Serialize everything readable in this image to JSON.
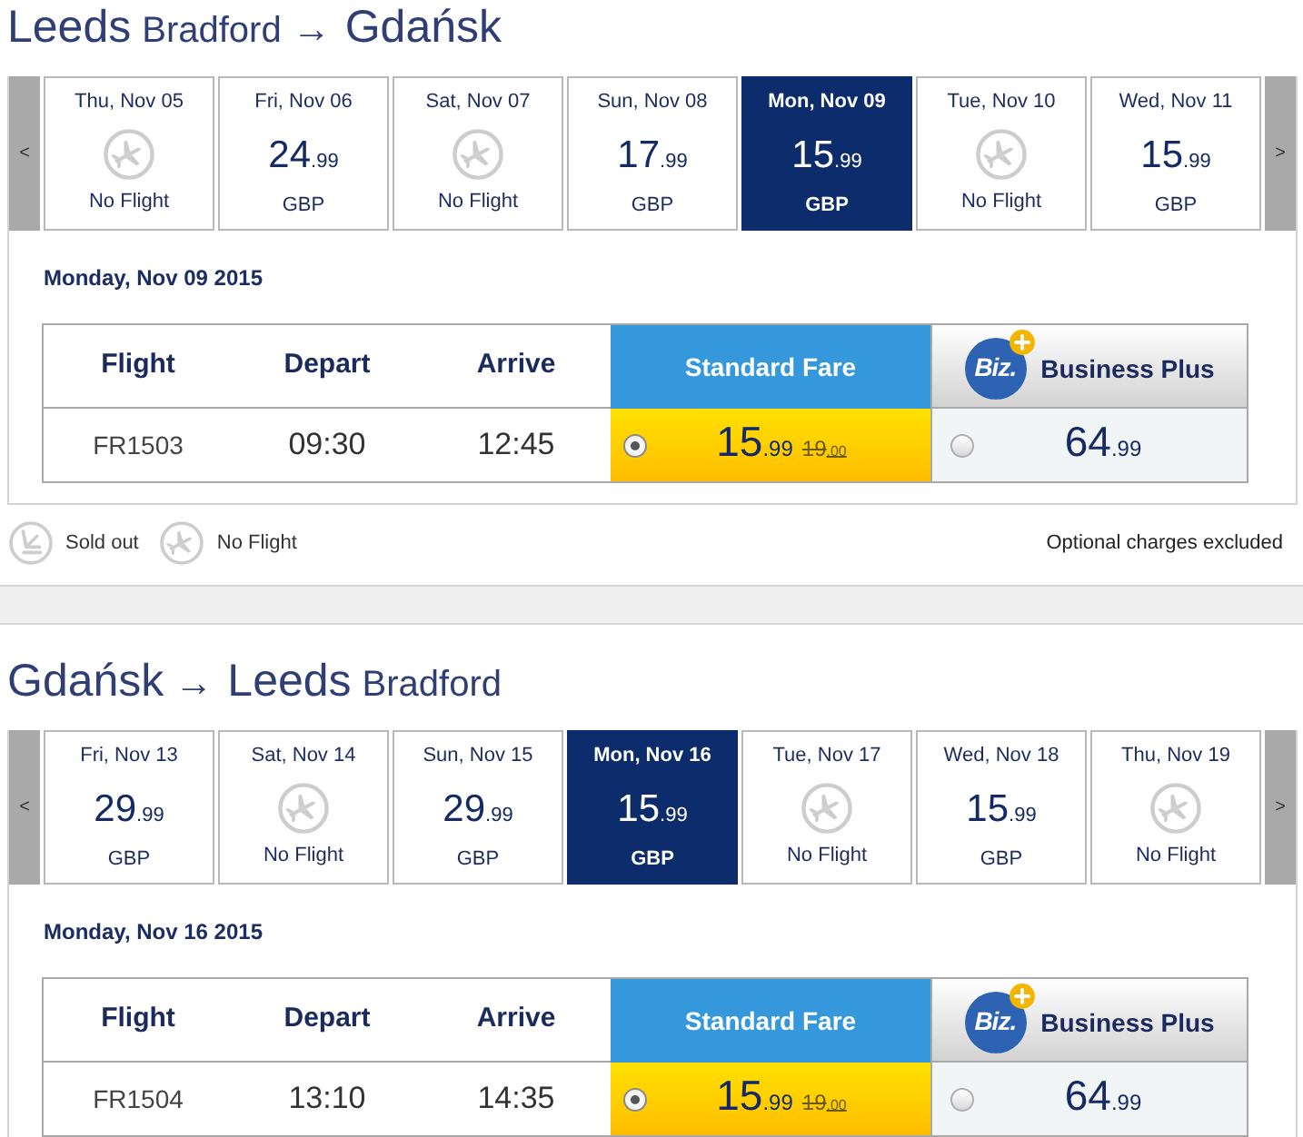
{
  "journeys": [
    {
      "title": [
        {
          "kind": "city",
          "text": "Leeds"
        },
        {
          "kind": "airport",
          "text": "Bradford"
        },
        {
          "kind": "arrow",
          "text": "→"
        },
        {
          "kind": "city",
          "text": "Gdańsk"
        }
      ],
      "date_strip": {
        "prev": "<",
        "next": ">",
        "days": [
          {
            "label": "Thu, Nov 05",
            "kind": "no_flight",
            "note": "No Flight",
            "selected": false
          },
          {
            "label": "Fri, Nov 06",
            "kind": "fare",
            "price": "24",
            "cents": ".99",
            "currency": "GBP",
            "selected": false
          },
          {
            "label": "Sat, Nov 07",
            "kind": "no_flight",
            "note": "No Flight",
            "selected": false
          },
          {
            "label": "Sun, Nov 08",
            "kind": "fare",
            "price": "17",
            "cents": ".99",
            "currency": "GBP",
            "selected": false
          },
          {
            "label": "Mon, Nov 09",
            "kind": "fare",
            "price": "15",
            "cents": ".99",
            "currency": "GBP",
            "selected": true
          },
          {
            "label": "Tue, Nov 10",
            "kind": "no_flight",
            "note": "No Flight",
            "selected": false
          },
          {
            "label": "Wed, Nov 11",
            "kind": "fare",
            "price": "15",
            "cents": ".99",
            "currency": "GBP",
            "selected": false
          }
        ]
      },
      "date_heading": "Monday, Nov 09 2015",
      "table": {
        "columns": [
          "Flight",
          "Depart",
          "Arrive"
        ],
        "fare_columns": [
          {
            "kind": "standard",
            "label": "Standard Fare"
          },
          {
            "kind": "business",
            "label": "Business Plus",
            "logo_text": "Biz."
          }
        ],
        "rows": [
          {
            "flight": "FR1503",
            "depart": "09:30",
            "arrive": "12:45",
            "fares": [
              {
                "price": "15",
                "cents": ".99",
                "old_price": "19",
                "old_cents": ".00",
                "selected": true
              },
              {
                "price": "64",
                "cents": ".99",
                "selected": false
              }
            ]
          }
        ]
      },
      "legend": {
        "items": [
          {
            "kind": "sold_out",
            "label": "Sold out"
          },
          {
            "kind": "no_flight",
            "label": "No Flight"
          }
        ],
        "note": "Optional charges excluded"
      }
    },
    {
      "title": [
        {
          "kind": "city",
          "text": "Gdańsk"
        },
        {
          "kind": "arrow",
          "text": "→"
        },
        {
          "kind": "city",
          "text": "Leeds"
        },
        {
          "kind": "airport",
          "text": "Bradford"
        }
      ],
      "date_strip": {
        "prev": "<",
        "next": ">",
        "days": [
          {
            "label": "Fri, Nov 13",
            "kind": "fare",
            "price": "29",
            "cents": ".99",
            "currency": "GBP",
            "selected": false
          },
          {
            "label": "Sat, Nov 14",
            "kind": "no_flight",
            "note": "No Flight",
            "selected": false
          },
          {
            "label": "Sun, Nov 15",
            "kind": "fare",
            "price": "29",
            "cents": ".99",
            "currency": "GBP",
            "selected": false
          },
          {
            "label": "Mon, Nov 16",
            "kind": "fare",
            "price": "15",
            "cents": ".99",
            "currency": "GBP",
            "selected": true
          },
          {
            "label": "Tue, Nov 17",
            "kind": "no_flight",
            "note": "No Flight",
            "selected": false
          },
          {
            "label": "Wed, Nov 18",
            "kind": "fare",
            "price": "15",
            "cents": ".99",
            "currency": "GBP",
            "selected": false
          },
          {
            "label": "Thu, Nov 19",
            "kind": "no_flight",
            "note": "No Flight",
            "selected": false
          }
        ]
      },
      "date_heading": "Monday, Nov 16 2015",
      "table": {
        "columns": [
          "Flight",
          "Depart",
          "Arrive"
        ],
        "fare_columns": [
          {
            "kind": "standard",
            "label": "Standard Fare"
          },
          {
            "kind": "business",
            "label": "Business Plus",
            "logo_text": "Biz."
          }
        ],
        "rows": [
          {
            "flight": "FR1504",
            "depart": "13:10",
            "arrive": "14:35",
            "fares": [
              {
                "price": "15",
                "cents": ".99",
                "old_price": "19",
                "old_cents": ".00",
                "selected": true
              },
              {
                "price": "64",
                "cents": ".99",
                "selected": false
              }
            ]
          }
        ]
      }
    }
  ]
}
